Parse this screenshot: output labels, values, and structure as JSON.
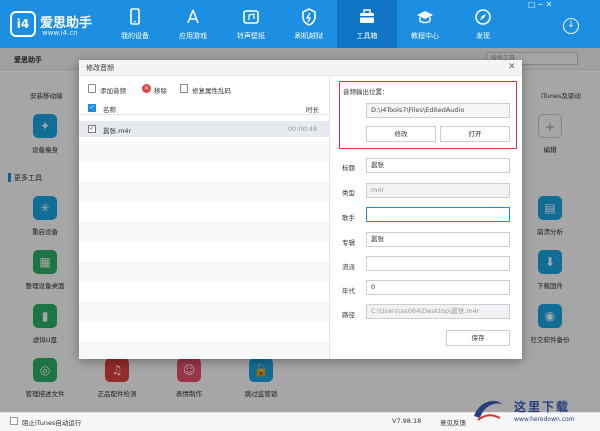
{
  "app": {
    "name": "爱思助手",
    "url": "www.i4.cn",
    "version": "V7.98.18",
    "feedback": "意见反馈"
  },
  "nav": [
    {
      "label": "我的设备",
      "icon": "phone-icon"
    },
    {
      "label": "应用游戏",
      "icon": "appstore-icon"
    },
    {
      "label": "铃声壁纸",
      "icon": "ringtone-icon"
    },
    {
      "label": "刷机越狱",
      "icon": "flash-icon"
    },
    {
      "label": "工具箱",
      "icon": "toolbox-icon",
      "active": true
    },
    {
      "label": "教程中心",
      "icon": "graduation-icon"
    },
    {
      "label": "发现",
      "icon": "compass-icon"
    }
  ],
  "window_controls": "□ ─ ✕",
  "subbar": {
    "title": "爱思助手",
    "search_placeholder": "搜索工具"
  },
  "background": {
    "top_left_label": "安装移动端",
    "top_right_label": "iTunes及驱动",
    "section_title": "更多工具",
    "tiles": [
      {
        "label": "设备瘦身"
      },
      {
        "label": "编辑"
      },
      {
        "label": "重启设备"
      },
      {
        "label": "崩溃分析"
      },
      {
        "label": "整理设备桌面"
      },
      {
        "label": "下载固件"
      },
      {
        "label": "虚拟U盘"
      },
      {
        "label": "社交软件备份"
      },
      {
        "label": "管理描述文件"
      },
      {
        "label": "正品配件检测"
      },
      {
        "label": "表情制作"
      },
      {
        "label": "跳过监管锁"
      }
    ]
  },
  "statusbar": {
    "itunes_label": "阻止iTunes自动运行"
  },
  "watermark": {
    "text": "这里下载",
    "url": "www.heredown.com"
  },
  "dialog": {
    "title": "修改音频",
    "close": "✕",
    "toolbar": {
      "add": "添加音频",
      "remove": "移除",
      "fix": "修复属性乱码"
    },
    "list": {
      "col_name": "名称",
      "col_duration": "时长",
      "rows": [
        {
          "name": "嚣张.m4r",
          "duration": "00:00:48"
        }
      ]
    },
    "output": {
      "label": "音频输出位置：",
      "path": "D:\\i4Tools7\\Files\\EditedAudio",
      "modify": "修改",
      "open": "打开"
    },
    "fields": {
      "title_label": "标题",
      "title_value": "嚣张",
      "type_label": "类型",
      "type_value": "m4r",
      "artist_label": "歌手",
      "artist_value": "",
      "album_label": "专辑",
      "album_value": "嚣张",
      "genre_label": "流派",
      "genre_value": "",
      "year_label": "年代",
      "year_value": "0",
      "path_label": "路径",
      "path_value": "C:\\Users\\as064\\Desktop\\嚣张.m4r"
    },
    "save": "保存"
  },
  "colors": {
    "brand": "#1d8fe3",
    "highlight": "#e03131"
  }
}
